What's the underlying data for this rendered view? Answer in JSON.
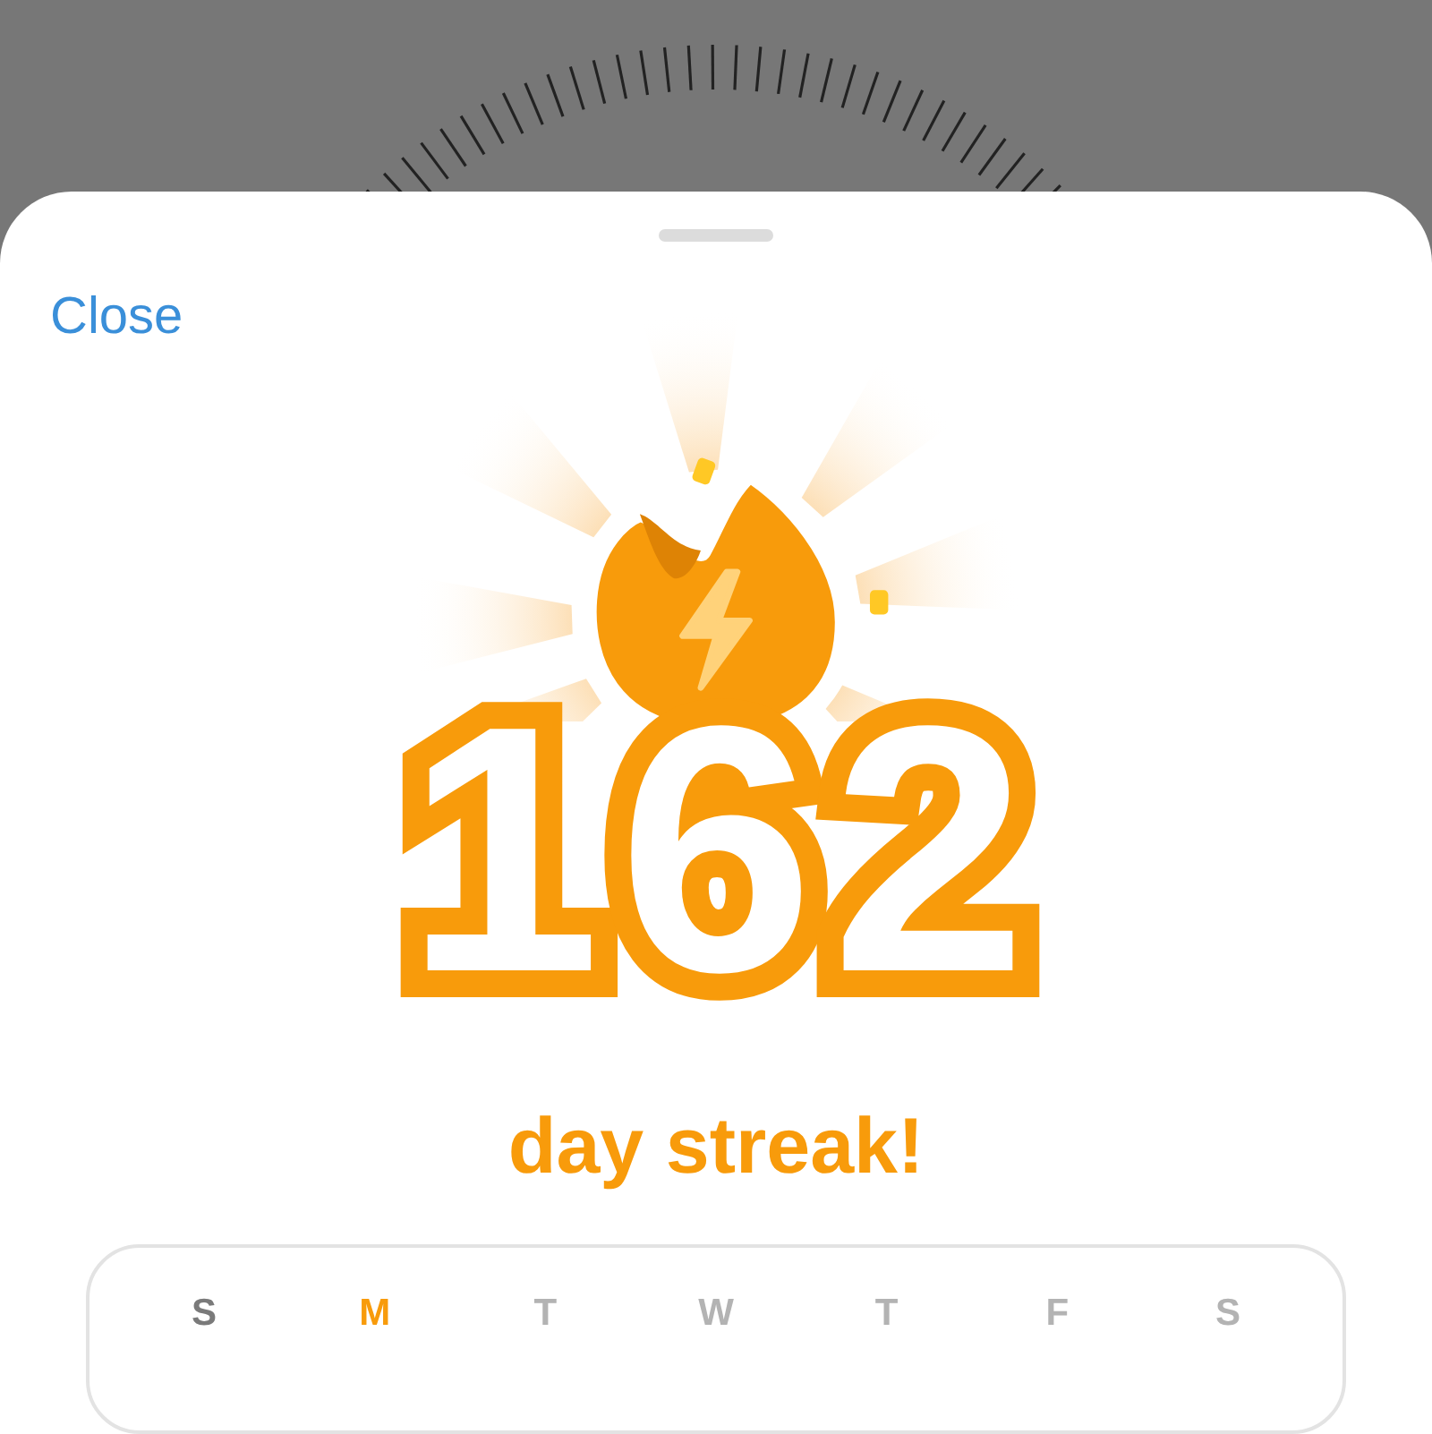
{
  "sheet": {
    "close_label": "Close"
  },
  "streak": {
    "count": "162",
    "caption": "day streak!"
  },
  "week": {
    "days": [
      {
        "label": "S",
        "kind": "past"
      },
      {
        "label": "M",
        "kind": "today"
      },
      {
        "label": "T",
        "kind": "future"
      },
      {
        "label": "W",
        "kind": "future"
      },
      {
        "label": "T",
        "kind": "future"
      },
      {
        "label": "F",
        "kind": "future"
      },
      {
        "label": "S",
        "kind": "future"
      }
    ]
  }
}
